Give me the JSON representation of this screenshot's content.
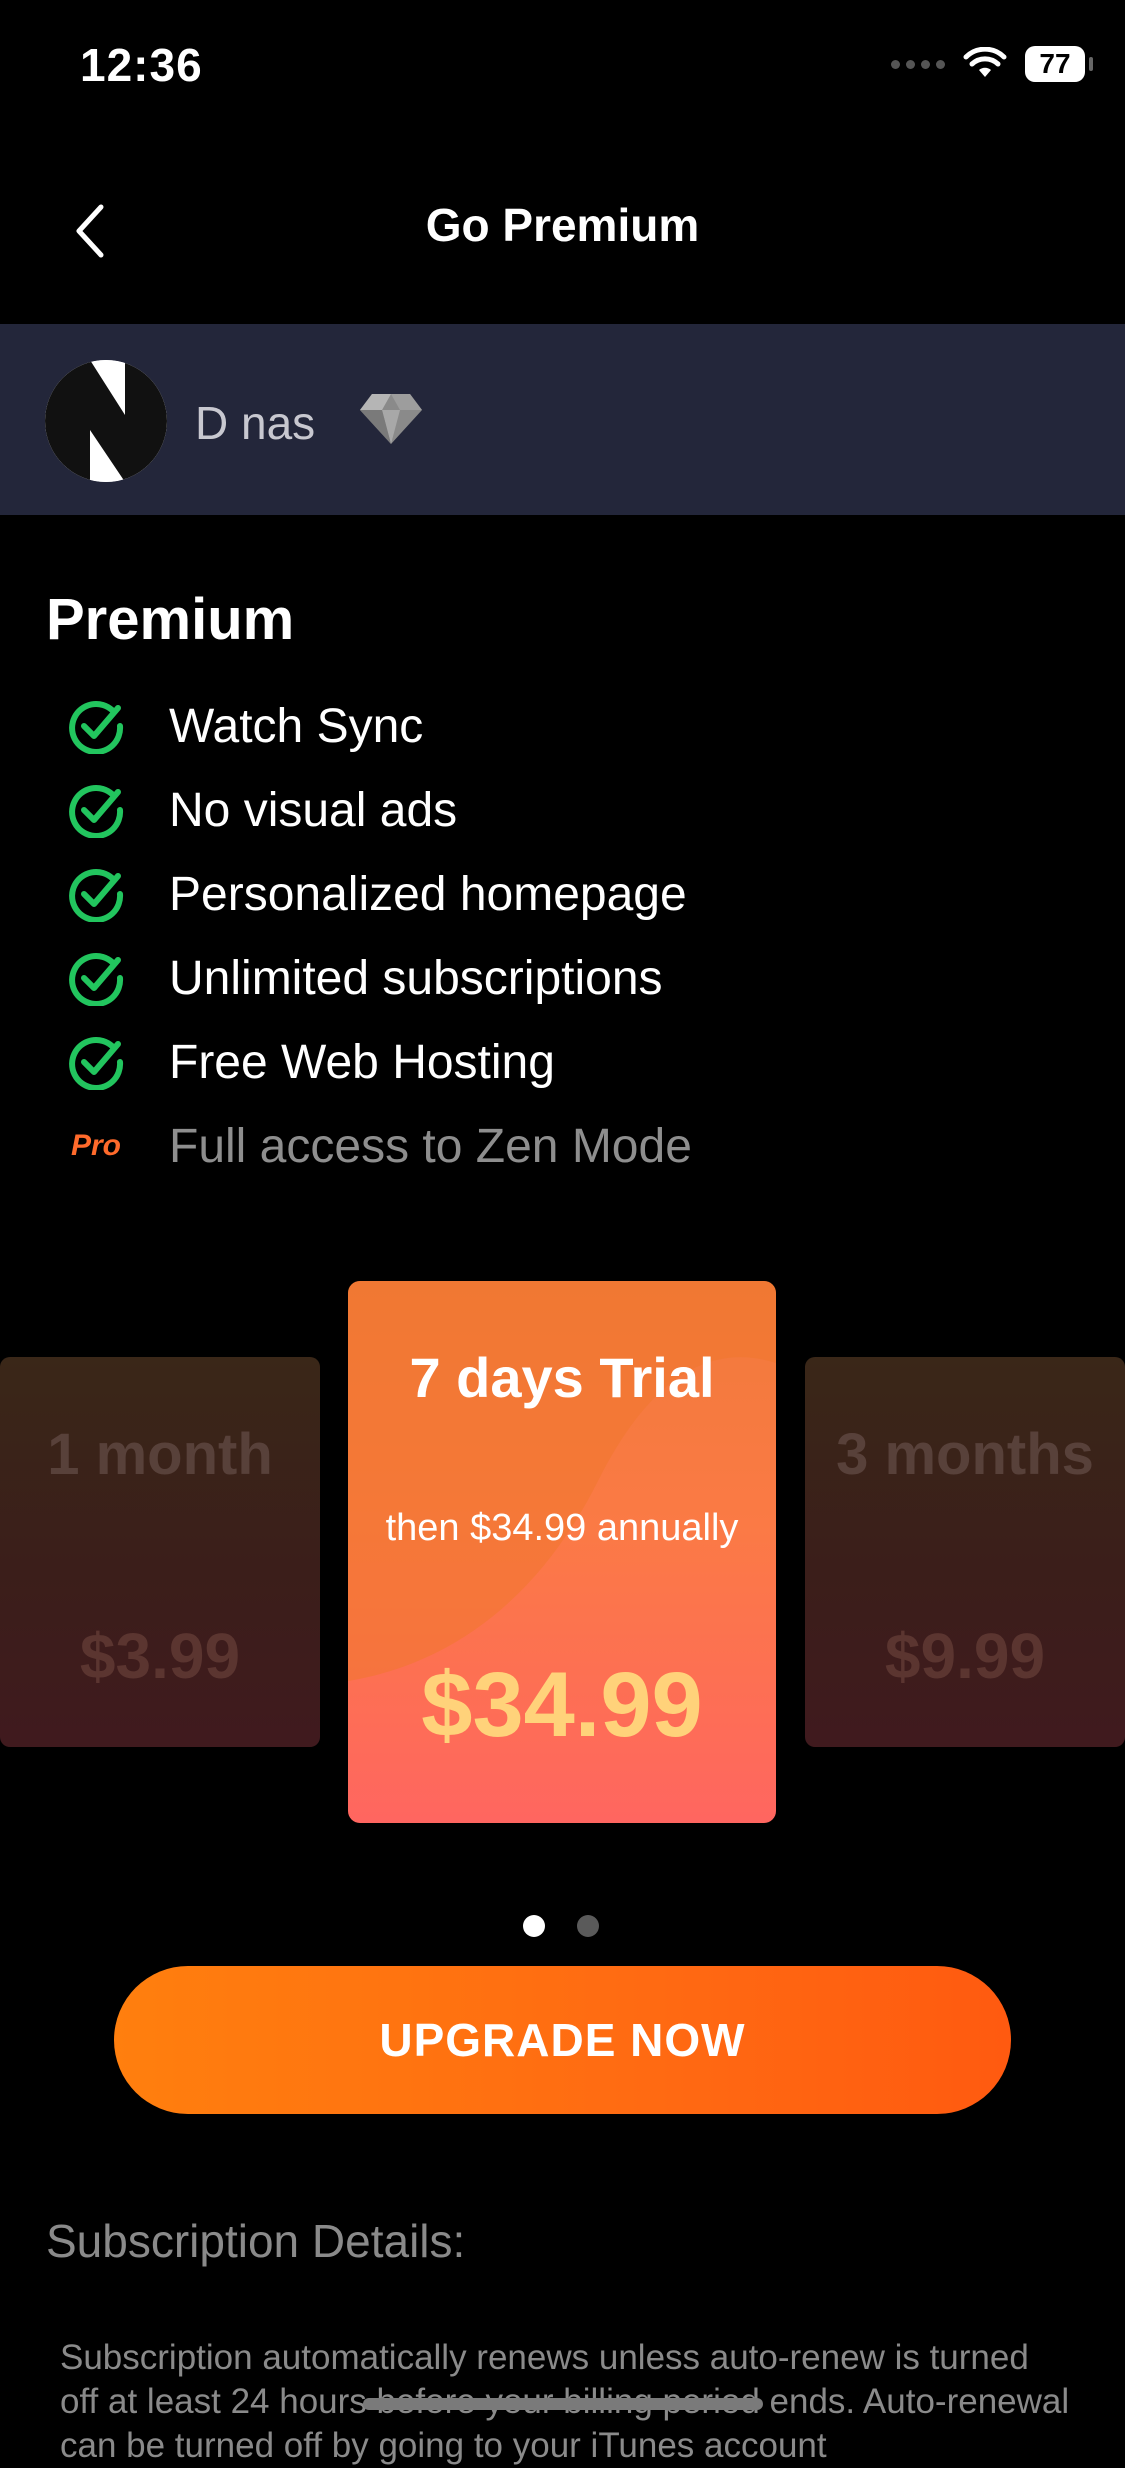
{
  "status_bar": {
    "time": "12:36",
    "battery": "77"
  },
  "nav": {
    "title": "Go Premium"
  },
  "user": {
    "name": "D nas"
  },
  "premium": {
    "title": "Premium",
    "features": [
      {
        "label": "Watch Sync",
        "icon": "check-circle-icon"
      },
      {
        "label": "No visual ads",
        "icon": "check-circle-icon"
      },
      {
        "label": "Personalized homepage",
        "icon": "check-circle-icon"
      },
      {
        "label": "Unlimited subscriptions",
        "icon": "check-circle-icon"
      },
      {
        "label": "Free Web Hosting",
        "icon": "check-circle-icon"
      },
      {
        "label": "Full access to Zen Mode",
        "icon": "pro-badge",
        "badge": "Pro"
      }
    ]
  },
  "plans": [
    {
      "name": "1 month",
      "price": "$3.99"
    },
    {
      "name": "7 days Trial",
      "subtitle": "then $34.99 annually",
      "price": "$34.99",
      "selected": true
    },
    {
      "name": "3 months",
      "price": "$9.99"
    }
  ],
  "pager": {
    "count": 2,
    "active": 0
  },
  "upgrade_button": "UPGRADE NOW",
  "subscription": {
    "title": "Subscription Details:",
    "body": "Subscription automatically renews unless auto-renew is turned off at least 24 hours before your billing period ends. Auto-renewal can be turned off by going to your iTunes account"
  },
  "colors": {
    "accent": "#ff7a12",
    "check": "#22c55e",
    "price_highlight": "#ffd27a",
    "user_bar": "#23263a"
  }
}
